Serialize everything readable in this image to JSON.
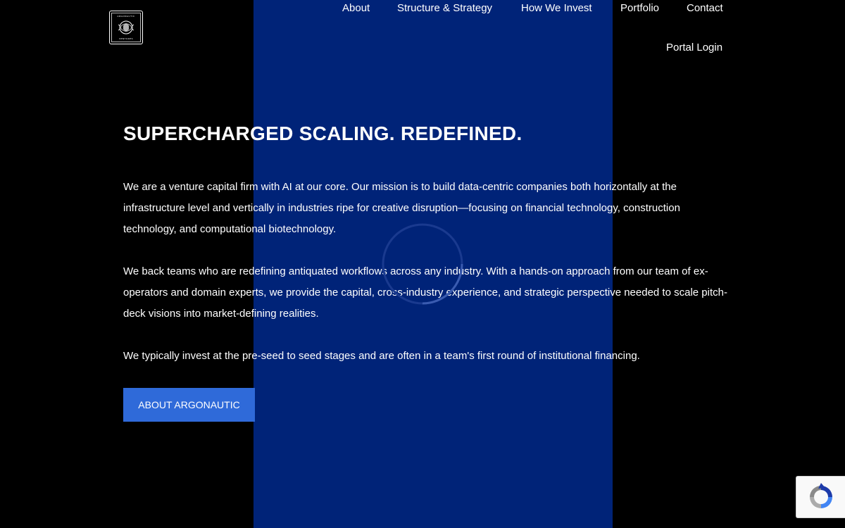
{
  "brand": {
    "logo_alt": "Argonautic Ventures",
    "logo_top": "ARGONAUTIC",
    "logo_bottom": "VENTURES"
  },
  "nav": {
    "items": [
      {
        "label": "About"
      },
      {
        "label": "Structure & Strategy"
      },
      {
        "label": "How We Invest"
      },
      {
        "label": "Portfolio"
      },
      {
        "label": "Contact"
      }
    ],
    "portal_login": "Portal Login"
  },
  "hero": {
    "headline": "SUPERCHARGED SCALING. REDEFINED.",
    "paragraphs": [
      "We are a venture capital firm with AI at our core. Our mission is to build data-centric companies both horizontally at the infrastructure level and vertically in industries ripe for creative disruption—focusing on financial technology, construction technology, and computational biotechnology.",
      "We back teams who are redefining antiquated workflows across any industry. With a hands-on approach from our team of ex-operators and domain experts, we provide the capital, cross-industry experience, and strategic perspective needed to scale pitch-deck visions into market-defining realities.",
      "We typically invest at the pre-seed to seed stages and are often in a team's first round of institutional financing."
    ],
    "cta_label": "ABOUT ARGONAUTIC"
  },
  "icons": {
    "loading": "loading-spinner-icon",
    "recaptcha": "recaptcha-icon"
  },
  "colors": {
    "background": "#000000",
    "panel_blue": "#002378",
    "button_blue": "#2f6ad9",
    "text": "#ffffff"
  }
}
